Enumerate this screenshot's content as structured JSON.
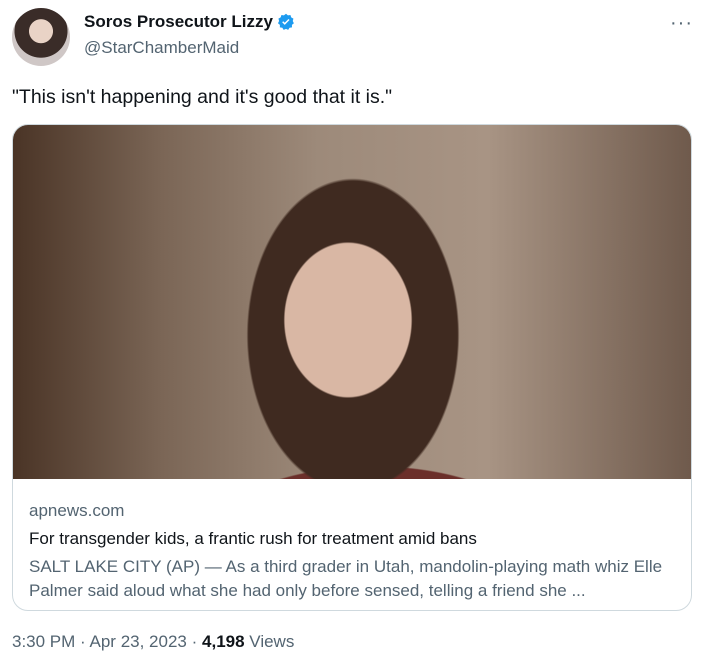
{
  "author": {
    "name": "Soros Prosecutor Lizzy",
    "handle": "@StarChamberMaid",
    "verified": true
  },
  "tweet": {
    "text": "\"This isn't happening and it's good that it is.\""
  },
  "card": {
    "domain": "apnews.com",
    "title": "For transgender kids, a frantic rush for treatment amid bans",
    "description": "SALT LAKE CITY (AP) — As a third grader in Utah, mandolin-playing math whiz Elle Palmer said aloud what she had only before sensed, telling a friend she ..."
  },
  "meta": {
    "time": "3:30 PM",
    "separator": "·",
    "date": "Apr 23, 2023",
    "views_count": "4,198",
    "views_label": "Views"
  },
  "icons": {
    "more": "more-options-icon",
    "verified": "verified-badge-icon"
  },
  "colors": {
    "text_primary": "#0f1419",
    "text_secondary": "#536471",
    "verified_blue": "#1d9bf0",
    "border": "#cfd9de"
  }
}
